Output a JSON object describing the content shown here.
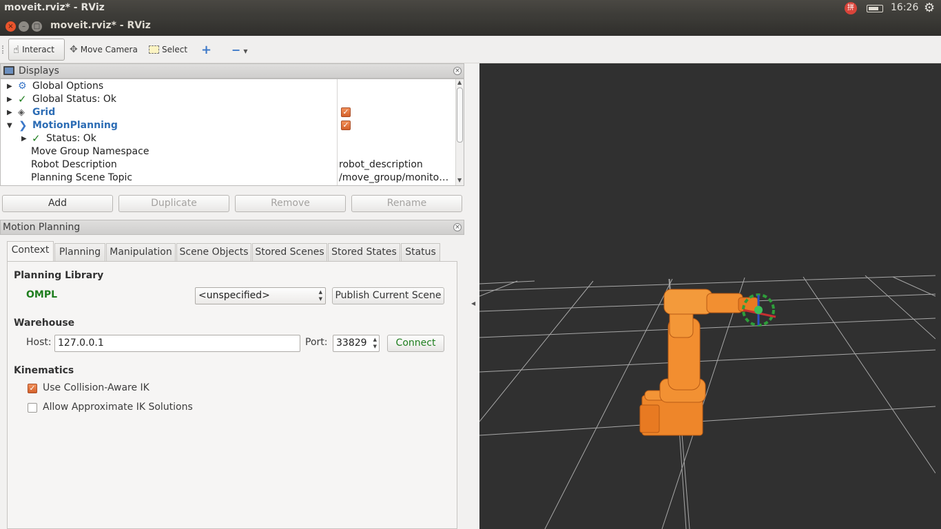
{
  "system_bar": {
    "title": "moveit.rviz* - RViz",
    "clock": "16:26"
  },
  "window": {
    "title": "moveit.rviz* - RViz"
  },
  "toolbar": {
    "interact": "Interact",
    "move_camera": "Move Camera",
    "select": "Select"
  },
  "displays": {
    "title": "Displays",
    "items": [
      {
        "label": "Global Options",
        "value": ""
      },
      {
        "label": "Global Status: Ok",
        "value": ""
      },
      {
        "label": "Grid",
        "value": ""
      },
      {
        "label": "MotionPlanning",
        "value": ""
      },
      {
        "label": "Status: Ok",
        "value": ""
      },
      {
        "label": "Move Group Namespace",
        "value": ""
      },
      {
        "label": "Robot Description",
        "value": "robot_description"
      },
      {
        "label": "Planning Scene Topic",
        "value": "/move_group/monito…"
      }
    ],
    "buttons": {
      "add": "Add",
      "duplicate": "Duplicate",
      "remove": "Remove",
      "rename": "Rename"
    }
  },
  "motion_planning": {
    "title": "Motion Planning",
    "tabs": [
      "Context",
      "Planning",
      "Manipulation",
      "Scene Objects",
      "Stored Scenes",
      "Stored States",
      "Status"
    ],
    "context": {
      "planning_library_label": "Planning Library",
      "library": "OMPL",
      "planner_select": "<unspecified>",
      "publish_button": "Publish Current Scene",
      "warehouse_label": "Warehouse",
      "host_label": "Host:",
      "host_value": "127.0.0.1",
      "port_label": "Port:",
      "port_value": "33829",
      "connect_button": "Connect",
      "kinematics_label": "Kinematics",
      "collision_aware_ik": "Use Collision-Aware IK",
      "approx_ik": "Allow Approximate IK Solutions"
    }
  },
  "colors": {
    "accent": "#e0703a",
    "link_blue": "#2d6db5",
    "ok_green": "#1e7e1e",
    "robot_orange": "#f08a2c",
    "viewport_bg": "#303030"
  }
}
